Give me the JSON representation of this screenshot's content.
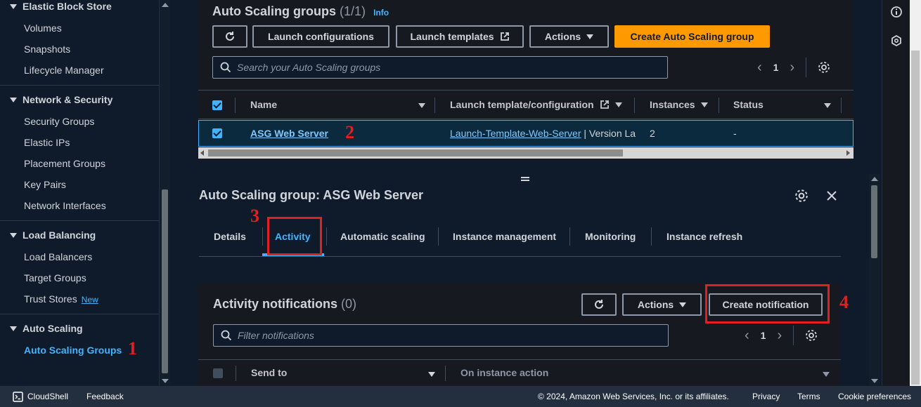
{
  "sidebar": {
    "sections": [
      {
        "title": "Elastic Block Store",
        "items": [
          "Volumes",
          "Snapshots",
          "Lifecycle Manager"
        ]
      },
      {
        "title": "Network & Security",
        "items": [
          "Security Groups",
          "Elastic IPs",
          "Placement Groups",
          "Key Pairs",
          "Network Interfaces"
        ]
      },
      {
        "title": "Load Balancing",
        "items": [
          "Load Balancers",
          "Target Groups",
          "Trust Stores"
        ]
      },
      {
        "title": "Auto Scaling",
        "items": [
          "Auto Scaling Groups"
        ]
      }
    ],
    "new_badge": "New",
    "active_item": "Auto Scaling Groups"
  },
  "asg_panel": {
    "title": "Auto Scaling groups",
    "count": "(1/1)",
    "info": "Info",
    "buttons": {
      "launch_configurations": "Launch configurations",
      "launch_templates": "Launch templates",
      "actions": "Actions",
      "create": "Create Auto Scaling group"
    },
    "search_placeholder": "Search your Auto Scaling groups",
    "page": "1",
    "columns": [
      "Name",
      "Launch template/configuration",
      "Instances",
      "Status"
    ],
    "rows": [
      {
        "name": "ASG Web Server",
        "launch_template": "Launch-Template-Web-Server",
        "version": "| Version La",
        "instances": "2",
        "status": "-"
      }
    ]
  },
  "detail": {
    "title": "Auto Scaling group: ASG Web Server",
    "tabs": [
      "Details",
      "Activity",
      "Automatic scaling",
      "Instance management",
      "Monitoring",
      "Instance refresh"
    ],
    "active_tab": "Activity"
  },
  "activity": {
    "title": "Activity notifications",
    "count": "(0)",
    "actions": "Actions",
    "create_notification": "Create notification",
    "filter_placeholder": "Filter notifications",
    "page": "1",
    "columns": [
      "Send to",
      "On instance action"
    ]
  },
  "annotations": [
    "1",
    "2",
    "3",
    "4"
  ],
  "footer": {
    "cloudshell": "CloudShell",
    "feedback": "Feedback",
    "copyright": "© 2024, Amazon Web Services, Inc. or its affiliates.",
    "privacy": "Privacy",
    "terms": "Terms",
    "cookie": "Cookie preferences"
  },
  "colors": {
    "accent": "#42b4ff",
    "primary": "#ff9900",
    "annotation": "#e12020"
  }
}
